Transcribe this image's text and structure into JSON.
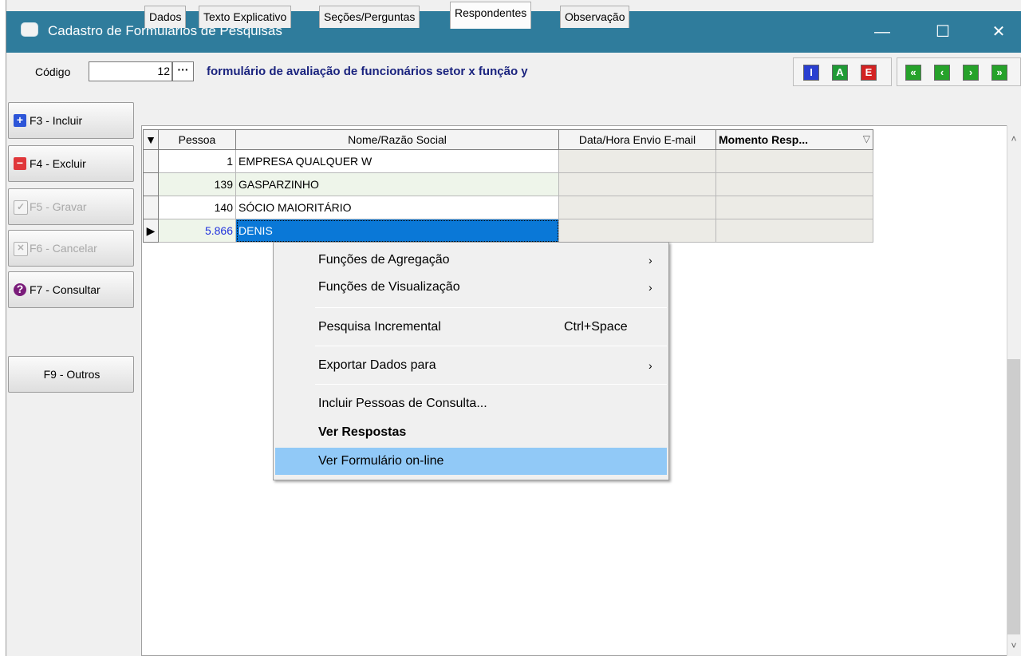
{
  "window": {
    "title": "Cadastro de Formulários de Pesquisas",
    "minimize": "—",
    "maximize": "☐",
    "close": "✕"
  },
  "header": {
    "codigo_label": "Código",
    "codigo_value": "12",
    "codigo_button": "···",
    "form_title": "formulário de avaliação de funcionários setor x função y",
    "toolbar_edit": [
      "I",
      "A",
      "E"
    ],
    "toolbar_nav": [
      "«",
      "‹",
      "›",
      "»"
    ],
    "colors": {
      "insert": "#2a3fd0",
      "alter": "#1f9a35",
      "delete": "#d32222",
      "nav": "#26a22a"
    }
  },
  "sidebar": {
    "f3": "F3 - Incluir",
    "f4": "F4 - Excluir",
    "f5": "F5 - Gravar",
    "f6": "F6 - Cancelar",
    "f7": "F7 - Consultar",
    "f9": "F9 - Outros",
    "f3_icon": "+",
    "f4_icon": "−",
    "f5_icon": "✓",
    "f6_icon": "✕",
    "f7_icon": "?"
  },
  "tabs": [
    "Dados",
    "Texto Explicativo",
    "Seções/Perguntas",
    "Respondentes",
    "Observação"
  ],
  "active_tab": "Respondentes",
  "grid": {
    "columns": [
      "Pessoa",
      "Nome/Razão Social",
      "Data/Hora Envio E-mail",
      "Momento Resp..."
    ],
    "sort_indicator": "▽",
    "header_marker": "▼",
    "current_row_marker": "▶",
    "rows": [
      {
        "pessoa": "1",
        "nome": "EMPRESA QUALQUER W",
        "data_envio": "",
        "momento": ""
      },
      {
        "pessoa": "139",
        "nome": "GASPARZINHO",
        "data_envio": "",
        "momento": ""
      },
      {
        "pessoa": "140",
        "nome": "SÓCIO MAIORITÁRIO",
        "data_envio": "",
        "momento": ""
      },
      {
        "pessoa": "5.866",
        "nome": "DENIS",
        "data_envio": "",
        "momento": ""
      }
    ]
  },
  "context_menu": {
    "items": [
      {
        "label": "Funções de Agregação",
        "submenu": "›"
      },
      {
        "label": "Funções de Visualização",
        "submenu": "›"
      },
      {
        "label": "Pesquisa Incremental",
        "shortcut": "Ctrl+Space"
      },
      {
        "label": "Exportar Dados para",
        "submenu": "›"
      },
      {
        "label": "Incluir Pessoas de Consulta..."
      },
      {
        "label": "Ver Respostas"
      },
      {
        "label": "Ver Formulário on-line"
      }
    ]
  },
  "scrollbar": {
    "up": "˄",
    "down": "˅"
  }
}
